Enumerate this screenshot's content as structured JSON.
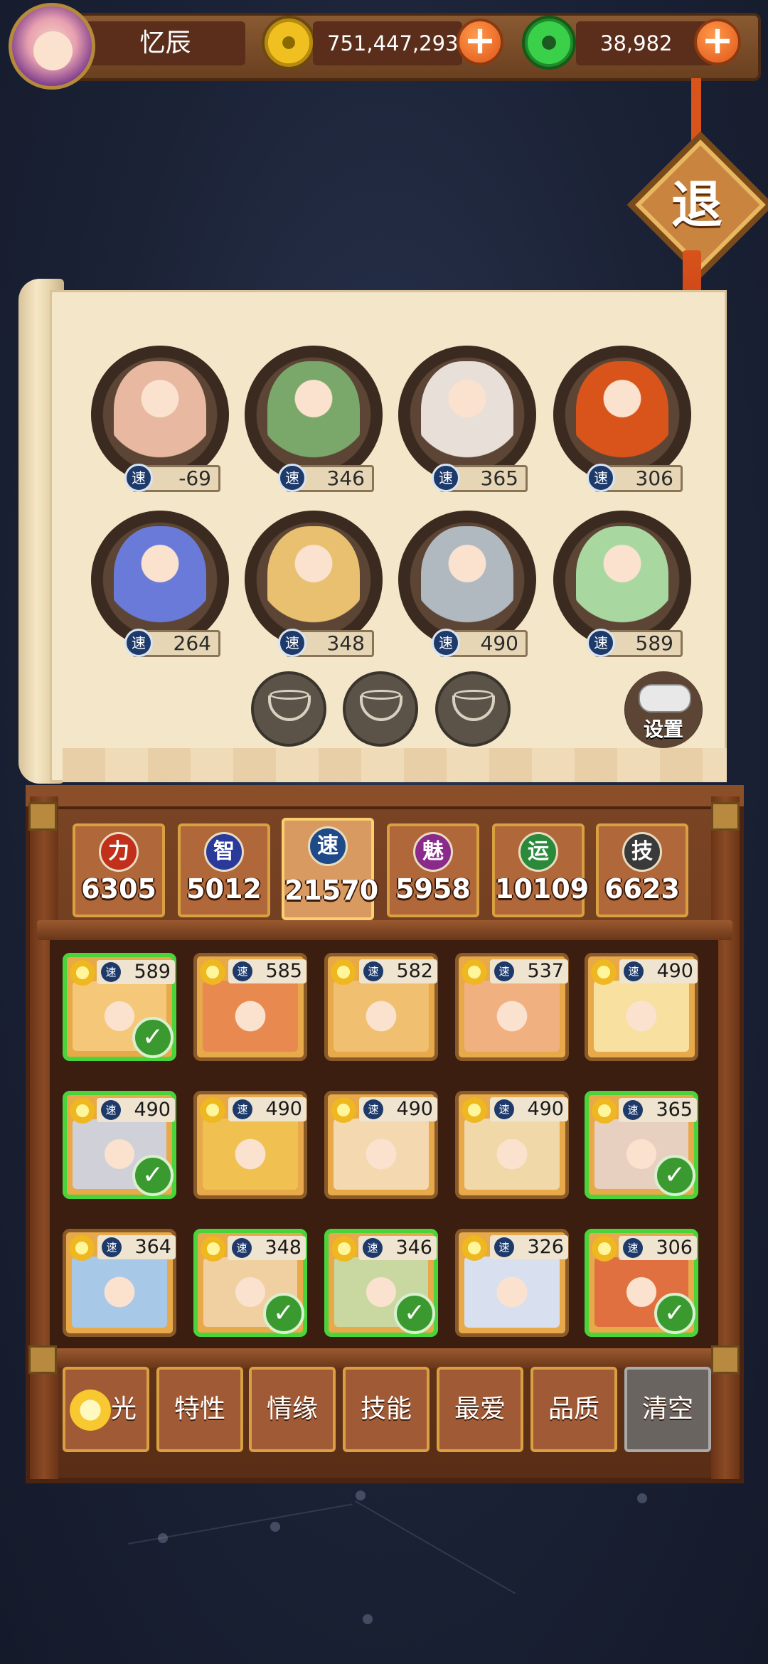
{
  "header": {
    "player_name": "忆辰",
    "gold": "751,447,293",
    "jade": "38,982"
  },
  "exit_label": "退",
  "speed_icon": "速",
  "team": [
    {
      "speed": "-69",
      "color": "#e8b8a0"
    },
    {
      "speed": "346",
      "color": "#7aa86a"
    },
    {
      "speed": "365",
      "color": "#e8e0d8"
    },
    {
      "speed": "306",
      "color": "#d8541a"
    },
    {
      "speed": "264",
      "color": "#6a7ad8"
    },
    {
      "speed": "348",
      "color": "#e8c070"
    },
    {
      "speed": "490",
      "color": "#b0b8c0"
    },
    {
      "speed": "589",
      "color": "#a8d8a0"
    }
  ],
  "settings_label": "设置",
  "stats": [
    {
      "icon": "力",
      "value": "6305",
      "color": "#c0301a"
    },
    {
      "icon": "智",
      "value": "5012",
      "color": "#2a3a9a"
    },
    {
      "icon": "速",
      "value": "21570",
      "color": "#1e4a8a"
    },
    {
      "icon": "魅",
      "value": "5958",
      "color": "#8a2a8a"
    },
    {
      "icon": "运",
      "value": "10109",
      "color": "#2a8a3a"
    },
    {
      "icon": "技",
      "value": "6623",
      "color": "#3a3a3a"
    }
  ],
  "characters": [
    {
      "speed": "589",
      "selected": true
    },
    {
      "speed": "585",
      "selected": false
    },
    {
      "speed": "582",
      "selected": false
    },
    {
      "speed": "537",
      "selected": false
    },
    {
      "speed": "490",
      "selected": false
    },
    {
      "speed": "490",
      "selected": true
    },
    {
      "speed": "490",
      "selected": false
    },
    {
      "speed": "490",
      "selected": false
    },
    {
      "speed": "490",
      "selected": false
    },
    {
      "speed": "365",
      "selected": true
    },
    {
      "speed": "364",
      "selected": false
    },
    {
      "speed": "348",
      "selected": true
    },
    {
      "speed": "346",
      "selected": true
    },
    {
      "speed": "326",
      "selected": false
    },
    {
      "speed": "306",
      "selected": true
    }
  ],
  "filters": [
    "光",
    "特性",
    "情缘",
    "技能",
    "最爱",
    "品质",
    "清空"
  ]
}
